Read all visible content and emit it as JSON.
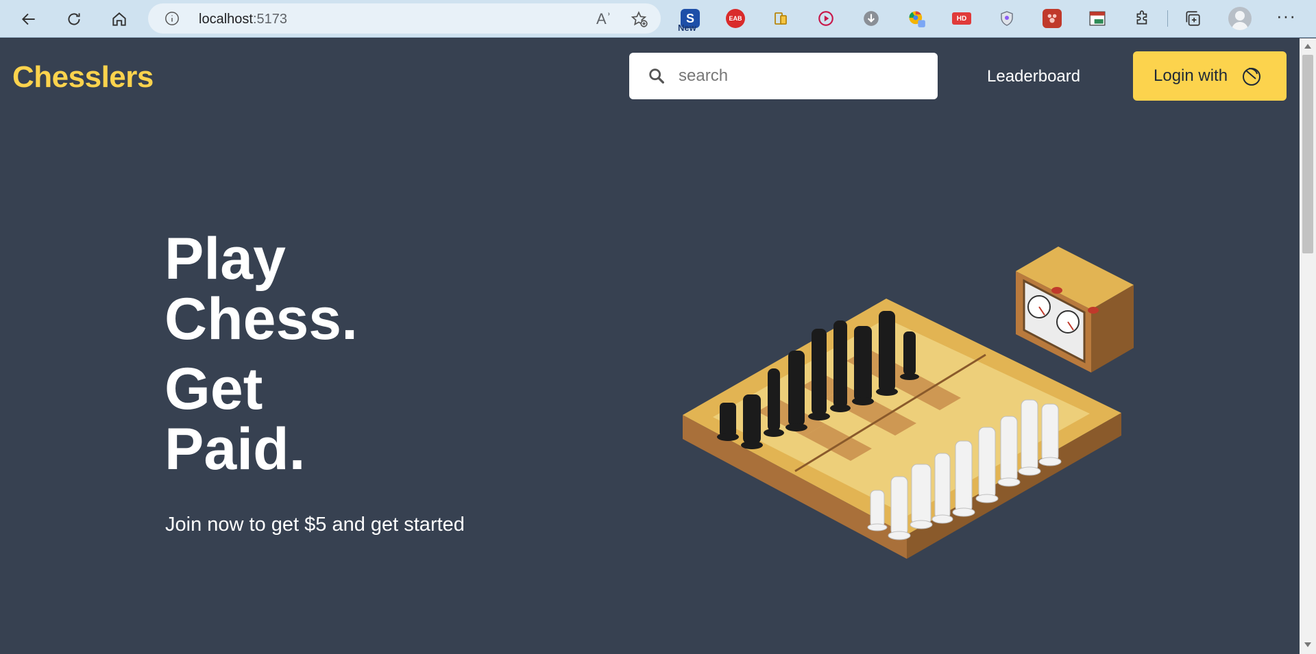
{
  "browser": {
    "url_host": "localhost",
    "url_port": ":5173",
    "read_aloud": "Aʾ",
    "ext_new_badge": "New",
    "ext_eab": "EAB",
    "ext_hd": "HD"
  },
  "header": {
    "logo": "Chesslers",
    "search_placeholder": "search",
    "leaderboard_label": "Leaderboard",
    "login_label": "Login with"
  },
  "hero": {
    "line1": "Play",
    "line2": "Chess.",
    "line3": "Get",
    "line4": "Paid.",
    "subtitle": "Join now to get $5 and get started"
  },
  "colors": {
    "background": "#374151",
    "accent": "#fcd34d",
    "text": "#ffffff"
  }
}
